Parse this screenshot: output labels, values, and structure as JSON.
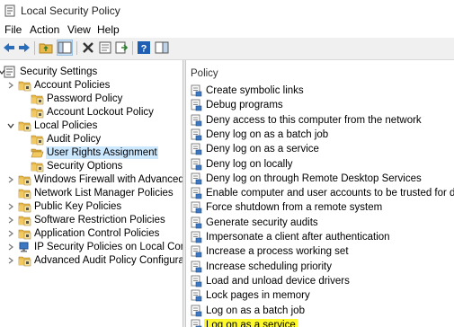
{
  "window": {
    "title": "Local Security Policy"
  },
  "menu": {
    "items": [
      "File",
      "Action",
      "View",
      "Help"
    ]
  },
  "toolbar": {
    "buttons": [
      "back-arrow-icon",
      "forward-arrow-icon",
      "up-folder-icon",
      "console-tree-icon",
      "delete-icon",
      "properties-icon",
      "export-list-icon",
      "help-icon",
      "show-hide-icon"
    ]
  },
  "tree": [
    {
      "label": "Security Settings",
      "level": 0,
      "expand": "down",
      "icon": "security-settings-icon"
    },
    {
      "label": "Account Policies",
      "level": 1,
      "expand": "right",
      "icon": "folder-icon"
    },
    {
      "label": "Password Policy",
      "level": 2,
      "expand": "none",
      "icon": "folder-icon"
    },
    {
      "label": "Account Lockout Policy",
      "level": 2,
      "expand": "none",
      "icon": "folder-icon"
    },
    {
      "label": "Local Policies",
      "level": 1,
      "expand": "down",
      "icon": "folder-icon"
    },
    {
      "label": "Audit Policy",
      "level": 2,
      "expand": "none",
      "icon": "folder-icon"
    },
    {
      "label": "User Rights Assignment",
      "level": 2,
      "expand": "none",
      "icon": "folder-open-icon",
      "selected": true
    },
    {
      "label": "Security Options",
      "level": 2,
      "expand": "none",
      "icon": "folder-icon"
    },
    {
      "label": "Windows Firewall with Advanced Secu",
      "level": 1,
      "expand": "right",
      "icon": "folder-icon"
    },
    {
      "label": "Network List Manager Policies",
      "level": 1,
      "expand": "none",
      "icon": "folder-icon"
    },
    {
      "label": "Public Key Policies",
      "level": 1,
      "expand": "right",
      "icon": "folder-icon"
    },
    {
      "label": "Software Restriction Policies",
      "level": 1,
      "expand": "right",
      "icon": "folder-icon"
    },
    {
      "label": "Application Control Policies",
      "level": 1,
      "expand": "right",
      "icon": "folder-icon"
    },
    {
      "label": "IP Security Policies on Local Compute",
      "level": 1,
      "expand": "right",
      "icon": "ip-security-icon"
    },
    {
      "label": "Advanced Audit Policy Configuration",
      "level": 1,
      "expand": "right",
      "icon": "folder-icon"
    }
  ],
  "list": {
    "column": "Policy",
    "rows": [
      {
        "label": "Create symbolic links"
      },
      {
        "label": "Debug programs"
      },
      {
        "label": "Deny access to this computer from the network"
      },
      {
        "label": "Deny log on as a batch job"
      },
      {
        "label": "Deny log on as a service"
      },
      {
        "label": "Deny log on locally"
      },
      {
        "label": "Deny log on through Remote Desktop Services"
      },
      {
        "label": "Enable computer and user accounts to be trusted for delega..."
      },
      {
        "label": "Force shutdown from a remote system"
      },
      {
        "label": "Generate security audits"
      },
      {
        "label": "Impersonate a client after authentication"
      },
      {
        "label": "Increase a process working set"
      },
      {
        "label": "Increase scheduling priority"
      },
      {
        "label": "Load and unload device drivers"
      },
      {
        "label": "Lock pages in memory"
      },
      {
        "label": "Log on as a batch job"
      },
      {
        "label": "Log on as a service",
        "highlighted": true
      }
    ]
  },
  "colors": {
    "selection": "#cce8ff",
    "highlight": "#fdf92b",
    "folder": "#e8b94a"
  }
}
